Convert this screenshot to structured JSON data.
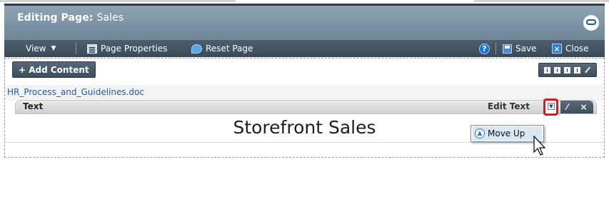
{
  "title": {
    "prefix": "Editing Page:",
    "page_name": "Sales"
  },
  "toolbar": {
    "view_label": "View",
    "page_properties_label": "Page Properties",
    "reset_page_label": "Reset Page",
    "save_label": "Save",
    "close_label": "Close"
  },
  "content": {
    "add_content_label": "+ Add Content",
    "document_link": "HR_Process_and_Guidelines.doc",
    "portlet_title": "Text",
    "edit_text_label": "Edit Text",
    "portlet_body_text": "Storefront Sales"
  },
  "menu": {
    "move_up_label": "Move Up"
  },
  "icons": {
    "view_menu": "chevron-down-icon",
    "page_properties": "page-properties-icon",
    "reset_page": "reset-icon",
    "help": "help-icon",
    "save": "save-icon",
    "close": "close-icon",
    "layout": [
      "layout-1-icon",
      "layout-2-icon",
      "layout-3-icon",
      "layout-4-icon",
      "edit-layout-icon"
    ],
    "portlet_menu": "portlet-actions-icon",
    "move_up": "move-up-icon",
    "logo": "oracle-logo-icon"
  },
  "colors": {
    "title_bar": "#7a91a3",
    "toolbar": "#43525f",
    "highlight_box": "#e0121c",
    "link": "#2654a3",
    "menu_highlight": "#d8e7f4"
  }
}
